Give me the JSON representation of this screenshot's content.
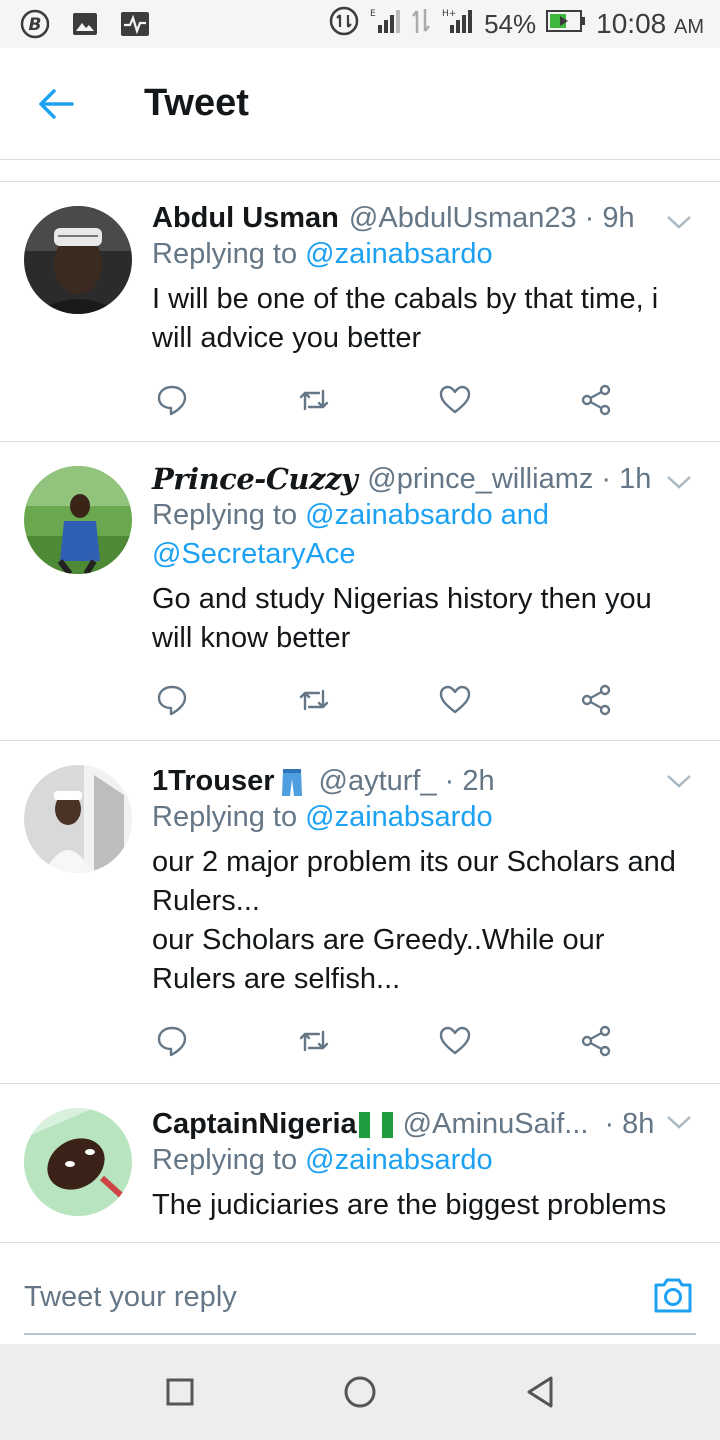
{
  "status_bar": {
    "left_icons": [
      "b-badge-icon",
      "image-icon",
      "pulse-icon"
    ],
    "battery_percent": "54%",
    "time": "10:08",
    "ampm": "AM"
  },
  "header": {
    "title": "Tweet"
  },
  "tweets": [
    {
      "name": "Abdul Usman",
      "handle": "@AbdulUsman23",
      "time": "· 9h",
      "replying_prefix": "Replying to",
      "replying_to": "@zainabsardo",
      "text": "I will be one of the cabals by that time, i will advice you better"
    },
    {
      "name": "Prince-Cuzzy",
      "handle": "@prince_williamz",
      "time": "· 1h",
      "replying_prefix": "Replying to",
      "replying_to": "@zainabsardo and @SecretaryAce",
      "text": "Go and study Nigerias history then you will know better"
    },
    {
      "name": "1Trouser",
      "handle": "@ayturf_",
      "time": "· 2h",
      "replying_prefix": "Replying to",
      "replying_to": "@zainabsardo",
      "text_lines": [
        "our 2 major problem its our Scholars and Rulers...",
        "our Scholars are Greedy..While our Rulers are selfish..."
      ]
    },
    {
      "name": "CaptainNigeria",
      "handle": "@AminuSaif...",
      "time": "· 8h",
      "replying_prefix": "Replying to",
      "replying_to": "@zainabsardo",
      "text": "The judiciaries are the biggest problems"
    }
  ],
  "reply_bar": {
    "placeholder": "Tweet your reply"
  },
  "colors": {
    "accent": "#1da1f2",
    "secondary_text": "#657786",
    "divider": "#d8dde2"
  },
  "icons": [
    "back-arrow-icon",
    "reply-icon",
    "retweet-icon",
    "like-icon",
    "share-icon",
    "chevron-down-icon",
    "camera-icon",
    "square-icon",
    "circle-icon",
    "triangle-back-icon"
  ]
}
